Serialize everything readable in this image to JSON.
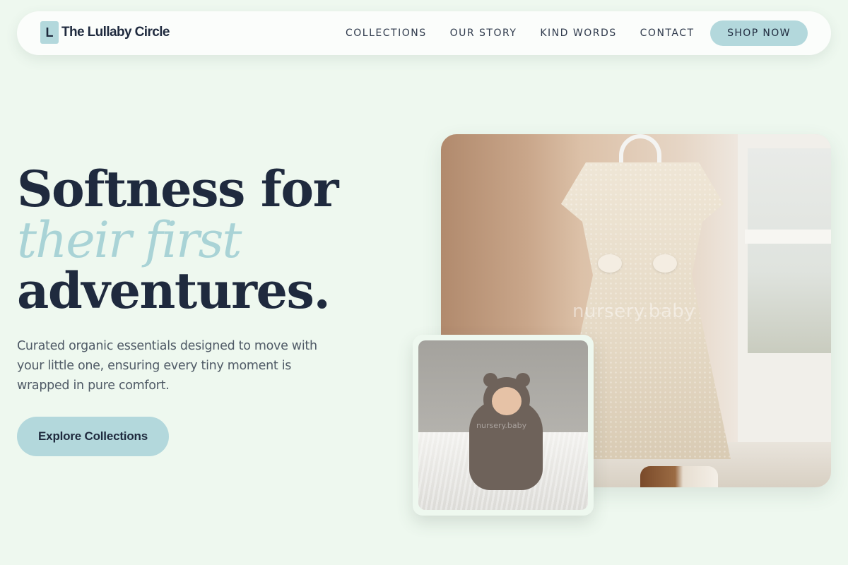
{
  "header": {
    "logo_mark": "L",
    "logo_text": "The Lullaby Circle",
    "nav": [
      {
        "label": "COLLECTIONS"
      },
      {
        "label": "OUR STORY"
      },
      {
        "label": "KIND WORDS"
      },
      {
        "label": "CONTACT"
      }
    ],
    "cta_label": "SHOP NOW"
  },
  "hero": {
    "title_line1": "Softness for",
    "title_line2": "their first",
    "title_line3": "adventures.",
    "subtitle": "Curated organic essentials designed to move with your little one, ensuring every tiny moment is wrapped in pure comfort.",
    "cta_label": "Explore Collections"
  },
  "images": {
    "main_watermark": "nursery.baby",
    "inset_watermark": "nursery.baby"
  },
  "colors": {
    "background": "#eef8ef",
    "accent": "#b3d8dc",
    "accent_text": "#a9d3d6",
    "ink": "#1f2a3e"
  }
}
